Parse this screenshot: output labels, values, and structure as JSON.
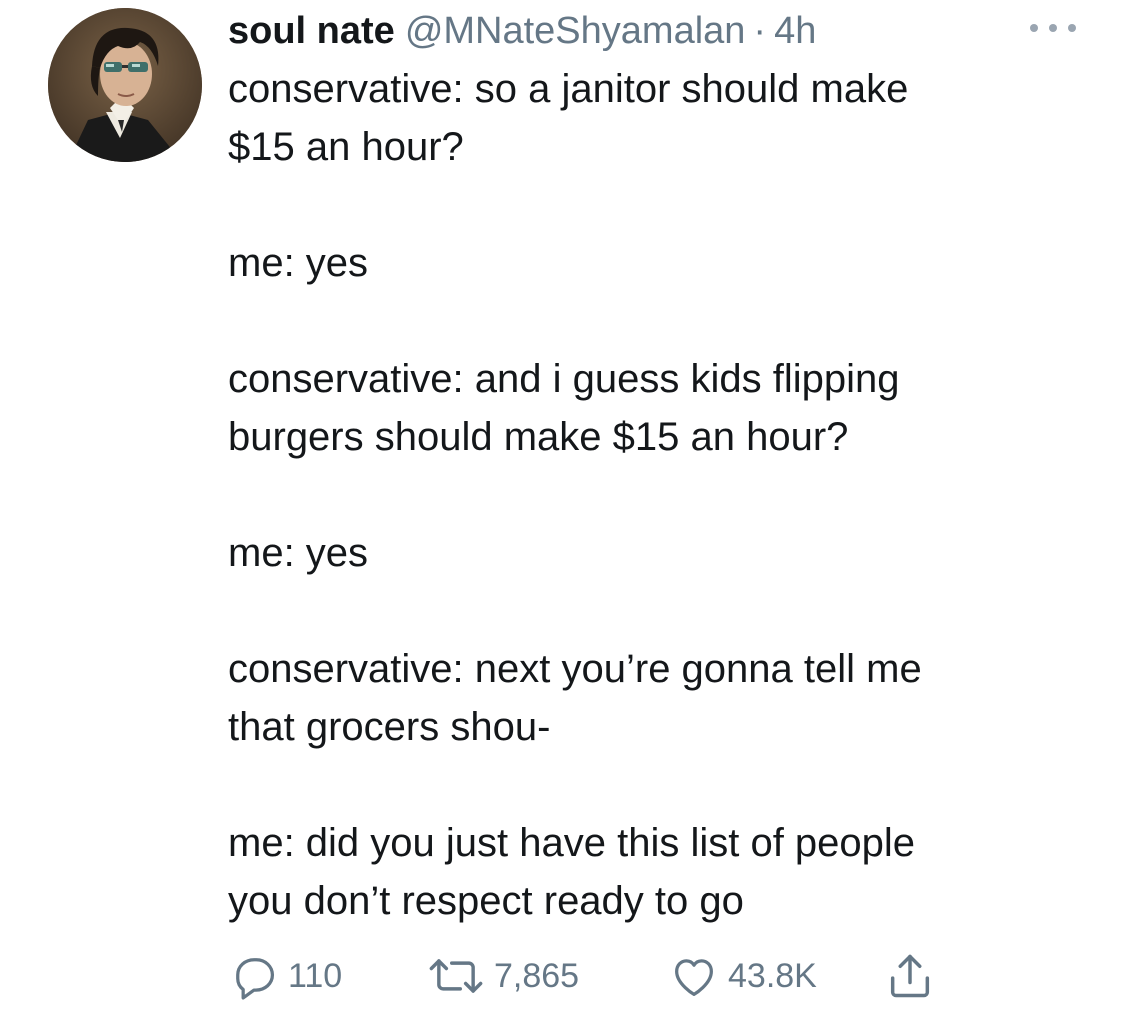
{
  "tweet": {
    "author_name": "soul nate",
    "handle": "@MNateShyamalan",
    "separator": "·",
    "time": "4h",
    "paragraphs": [
      [
        "conservative: so a janitor should make",
        "$15 an hour?"
      ],
      [
        "me: yes"
      ],
      [
        "conservative: and i guess kids flipping",
        "burgers should make $15 an hour?"
      ],
      [
        "me: yes"
      ],
      [
        "conservative: next you’re gonna tell me",
        "that grocers shou-"
      ],
      [
        "me: did you just have this list of people",
        "you don’t respect ready to go"
      ]
    ]
  },
  "actions": {
    "reply_count": "110",
    "retweet_count": "7,865",
    "like_count": "43.8K"
  },
  "icons": {
    "more": "more-dots-icon",
    "reply": "reply-icon",
    "retweet": "retweet-icon",
    "like": "heart-icon",
    "share": "share-icon"
  },
  "colors": {
    "text": "#14171a",
    "secondary": "#657786",
    "background": "#ffffff"
  }
}
